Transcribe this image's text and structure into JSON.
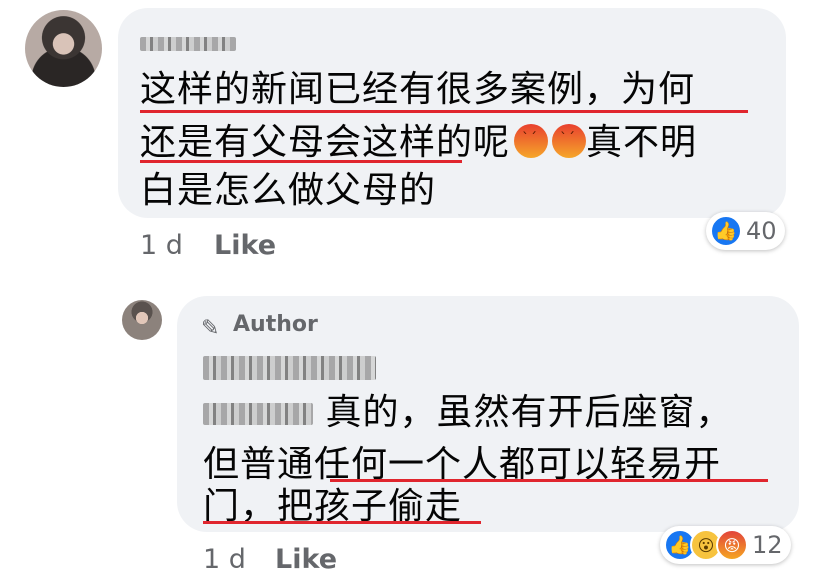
{
  "comment": {
    "author_blurred": true,
    "lines": [
      "这样的新闻已经有很多案例，为何",
      "还是有父母会这样的呢",
      "真不明",
      "白是怎么做父母的"
    ],
    "time": "1 d",
    "like_label": "Like",
    "reaction_count": "40"
  },
  "reply": {
    "author_tag": "Author",
    "mention_blurred": true,
    "lines": [
      "真的，虽然有开后座窗，",
      "但普通任何一个人都可以轻易开",
      "门，把孩子偷走"
    ],
    "time": "1 d",
    "like_label": "Like",
    "reaction_count": "12"
  },
  "colors": {
    "underline": "#e0262e",
    "like_blue": "#1877f2",
    "bubble": "#f0f2f5"
  },
  "icons": [
    "like-reaction-icon",
    "wow-reaction-icon",
    "angry-reaction-icon",
    "pencil-icon",
    "angry-emoji"
  ]
}
